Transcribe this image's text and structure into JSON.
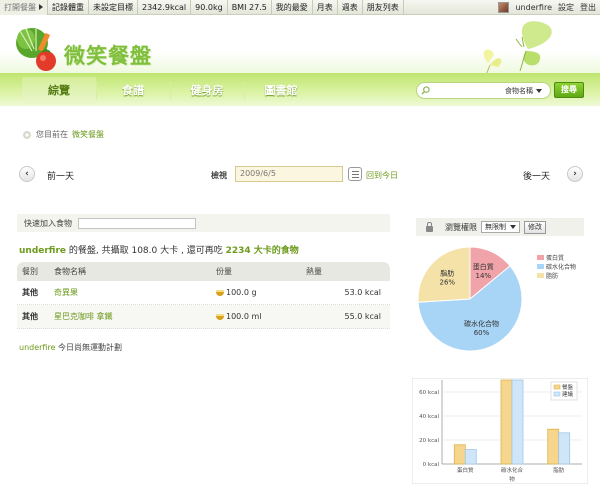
{
  "topbar": {
    "first": "打開餐盤",
    "items": [
      "記錄體重",
      "未設定目標",
      "2342.9kcal",
      "90.0kg",
      "BMI 27.5",
      "我的最愛",
      "月表",
      "週表",
      "朋友列表"
    ],
    "user": "underfire",
    "settings": "設定",
    "logout": "登出"
  },
  "logo": {
    "title": "微笑餐盤"
  },
  "nav": {
    "tabs": [
      "綜覽",
      "食譜",
      "健身房",
      "圖書館"
    ],
    "active": 0
  },
  "search": {
    "placeholder": "",
    "category": "食物名稱",
    "button": "搜尋"
  },
  "breadcrumb": {
    "prefix": "您目前在",
    "current": "微笑餐盤"
  },
  "datenav": {
    "prev": "前一天",
    "next": "後一天",
    "view_label": "檢視",
    "date": "2009/6/5",
    "today": "回到今日"
  },
  "addfood": {
    "label": "快速加入食物",
    "value": ""
  },
  "summary": {
    "user": "underfire",
    "text1": " 的餐盤, 共攝取 ",
    "intake": "108.0 大卡",
    "text2": " , 還可再吃 ",
    "remain": "2234 大卡的食物"
  },
  "food_table": {
    "headers": [
      "餐別",
      "食物名稱",
      "份量",
      "熱量"
    ],
    "rows": [
      {
        "meal": "其他",
        "name": "奇異果",
        "portion": "100.0 g",
        "kcal": "53.0 kcal"
      },
      {
        "meal": "其他",
        "name": "星巴克咖啡 拿鐵",
        "portion": "100.0 ml",
        "kcal": "55.0 kcal"
      }
    ]
  },
  "exercise": {
    "user": "underfire",
    "text": " 今日尚無運動計劃"
  },
  "privacy": {
    "label": "瀏覽權限",
    "value": "無限制",
    "button": "修改"
  },
  "colors": {
    "brand_green": "#7fbf3b",
    "link_green": "#6d9a1c",
    "protein": "#f0a3a8",
    "carb": "#a8d4f5",
    "fat": "#f5e2a8",
    "bar_mine": "#f6d68d",
    "bar_std": "#cfe6f8"
  },
  "chart_data": [
    {
      "type": "pie",
      "categories": [
        "蛋白質",
        "碳水化合物",
        "脂肪"
      ],
      "values": [
        14,
        60,
        26
      ],
      "slice_labels": [
        "蛋白質\n14%",
        "碳水化合物\n60%",
        "脂肪\n26%"
      ],
      "legend": [
        "蛋白質",
        "碳水化合物",
        "脂肪"
      ],
      "legend_position": "right"
    },
    {
      "type": "bar",
      "categories": [
        "蛋白質",
        "碳水化合\n物",
        "脂肪"
      ],
      "series": [
        {
          "name": "餐盤",
          "values": [
            16,
            70,
            29
          ]
        },
        {
          "name": "建議",
          "values": [
            12,
            70,
            26
          ]
        }
      ],
      "ylim": [
        0,
        70
      ],
      "yticks": [
        "0 kcal",
        "20 kcal",
        "40 kcal",
        "60 kcal"
      ],
      "ytick_values": [
        0,
        20,
        40,
        60
      ],
      "legend_position": "top-right",
      "grid": true
    }
  ]
}
